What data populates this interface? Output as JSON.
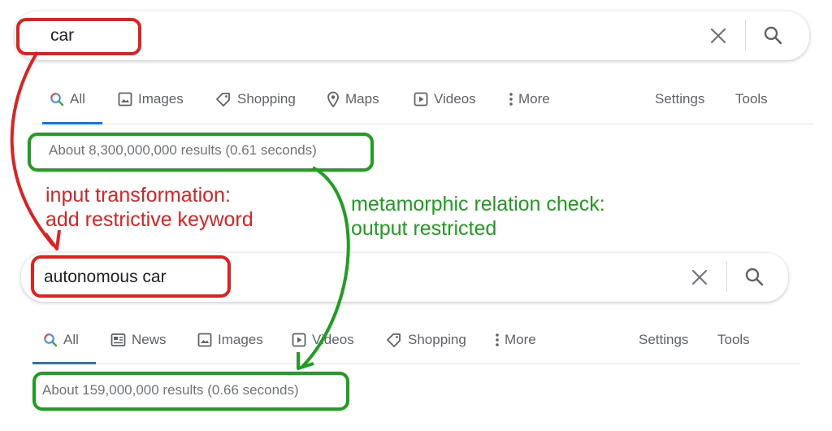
{
  "top": {
    "query": "car",
    "tabs": [
      {
        "label": "All",
        "icon": "search-icon"
      },
      {
        "label": "Images",
        "icon": "image-icon"
      },
      {
        "label": "Shopping",
        "icon": "tag-icon"
      },
      {
        "label": "Maps",
        "icon": "map-pin-icon"
      },
      {
        "label": "Videos",
        "icon": "video-icon"
      },
      {
        "label": "More",
        "icon": "more-dots-icon"
      }
    ],
    "settings": "Settings",
    "tools": "Tools",
    "stats": "About 8,300,000,000 results (0.61 seconds)"
  },
  "bottom": {
    "query": "autonomous car",
    "tabs": [
      {
        "label": "All",
        "icon": "search-icon"
      },
      {
        "label": "News",
        "icon": "news-icon"
      },
      {
        "label": "Images",
        "icon": "image-icon"
      },
      {
        "label": "Videos",
        "icon": "video-icon"
      },
      {
        "label": "Shopping",
        "icon": "tag-icon"
      },
      {
        "label": "More",
        "icon": "more-dots-icon"
      }
    ],
    "settings": "Settings",
    "tools": "Tools",
    "stats": "About 159,000,000 results (0.66 seconds)"
  },
  "annotations": {
    "input_line1": "input transformation:",
    "input_line2": "add restrictive keyword",
    "check_line1": "metamorphic relation check:",
    "check_line2": "output restricted"
  },
  "colors": {
    "annotation_red": "#e32020",
    "annotation_green": "#1f9e1f",
    "active_tab": "#1a73e8",
    "tab_text": "#5f6368",
    "stats_text": "#70757a"
  }
}
